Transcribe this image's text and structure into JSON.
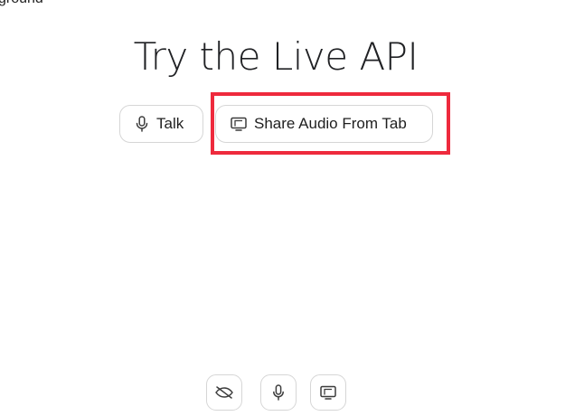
{
  "header": {
    "crumb": "ground",
    "title": "Try the Live API"
  },
  "actions": {
    "talk_label": "Talk",
    "share_label": "Share Audio From Tab"
  },
  "controls": [
    {
      "icon": "video-off-icon"
    },
    {
      "icon": "mic-icon"
    },
    {
      "icon": "screen-share-icon"
    }
  ],
  "colors": {
    "highlight": "#ee2a3d",
    "border": "#d6d6d6",
    "text": "#1f1f1f"
  }
}
